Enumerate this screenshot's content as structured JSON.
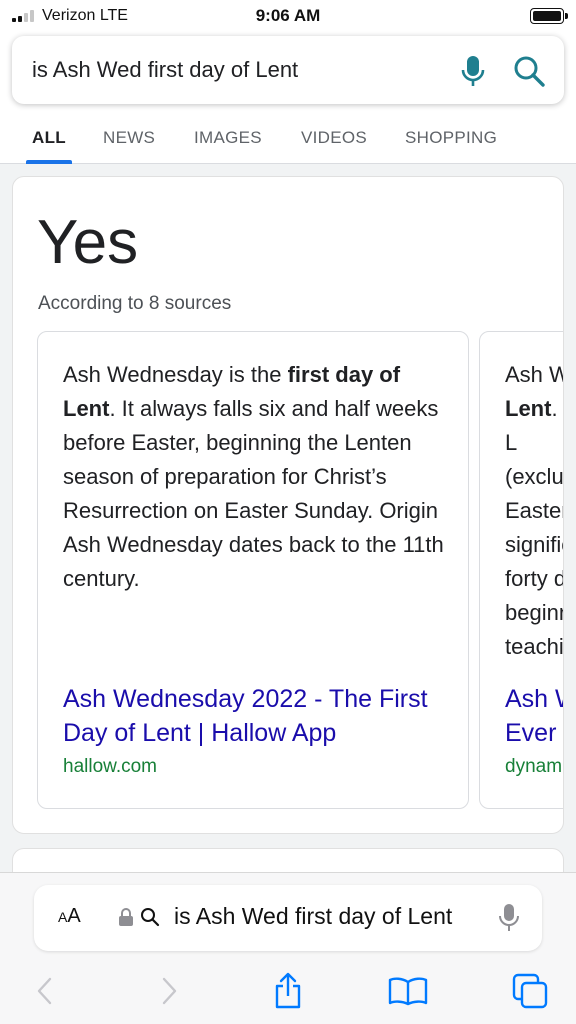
{
  "status_bar": {
    "carrier": "Verizon  LTE",
    "time": "9:06 AM"
  },
  "search": {
    "query": "is Ash Wed first day of Lent"
  },
  "tabs": [
    {
      "label": "ALL",
      "active": true
    },
    {
      "label": "NEWS"
    },
    {
      "label": "IMAGES"
    },
    {
      "label": "VIDEOS"
    },
    {
      "label": "SHOPPING"
    }
  ],
  "answer": {
    "text": "Yes",
    "sources": "According to 8 sources"
  },
  "snippets": [
    {
      "text_1": "Ash Wednesday is the ",
      "bold_1": "first day of Lent",
      "text_2": ". It always falls six and half weeks before Easter, beginning the Lenten season of preparation for Christ’s Resurrection on Easter Sunday. Origin Ash Wednesday dates back to the 11th century.",
      "title": "Ash Wednesday 2022 - The First Day of Lent | Hallow App",
      "domain": "hallow.com"
    },
    {
      "text_1": "Ash W",
      "bold_1": "Lent",
      "text_2": ". L (excluc Easter. signific forty d beginn teachin",
      "title": "Ash W Ever |",
      "domain": "dynami"
    }
  ],
  "safari": {
    "aa_label": "AA",
    "address_text": "is Ash Wed first day of Lent"
  },
  "colors": {
    "link": "#1a0dab",
    "domain": "#188038",
    "accent": "#1a73e8",
    "icon_teal": "#1a73e8",
    "ios_blue": "#007aff"
  }
}
